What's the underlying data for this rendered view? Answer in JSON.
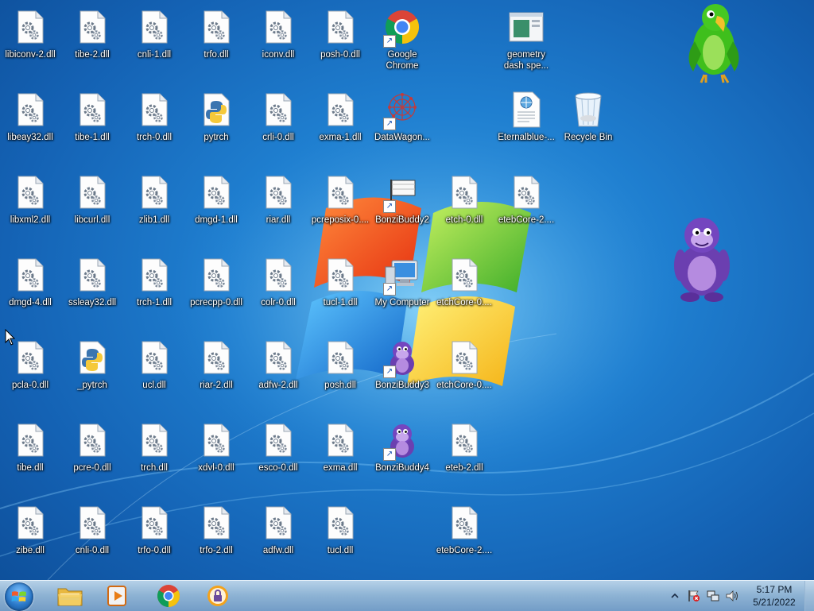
{
  "desktop": {
    "icons": [
      {
        "label": "libiconv-2.dll",
        "type": "dll"
      },
      {
        "label": "tibe-2.dll",
        "type": "dll"
      },
      {
        "label": "cnli-1.dll",
        "type": "dll"
      },
      {
        "label": "trfo.dll",
        "type": "dll"
      },
      {
        "label": "iconv.dll",
        "type": "dll"
      },
      {
        "label": "posh-0.dll",
        "type": "dll"
      },
      {
        "label": "Google Chrome",
        "type": "chrome-shortcut"
      },
      {
        "label": "geometry dash spe...",
        "type": "window-thumb"
      },
      {
        "label": "libeay32.dll",
        "type": "dll"
      },
      {
        "label": "tibe-1.dll",
        "type": "dll"
      },
      {
        "label": "trch-0.dll",
        "type": "dll"
      },
      {
        "label": "pytrch",
        "type": "python"
      },
      {
        "label": "crli-0.dll",
        "type": "dll"
      },
      {
        "label": "exma-1.dll",
        "type": "dll"
      },
      {
        "label": "DataWagon...",
        "type": "datawagon-shortcut"
      },
      {
        "label": "Eternalblue-...",
        "type": "html-doc"
      },
      {
        "label": "Recycle Bin",
        "type": "recycle-bin"
      },
      {
        "label": "libxml2.dll",
        "type": "dll"
      },
      {
        "label": "libcurl.dll",
        "type": "dll"
      },
      {
        "label": "zlib1.dll",
        "type": "dll"
      },
      {
        "label": "dmgd-1.dll",
        "type": "dll"
      },
      {
        "label": "riar.dll",
        "type": "dll"
      },
      {
        "label": "pcreposix-0....",
        "type": "dll"
      },
      {
        "label": "BonziBuddy2",
        "type": "flag-shortcut"
      },
      {
        "label": "etch-0.dll",
        "type": "dll"
      },
      {
        "label": "etebCore-2....",
        "type": "dll"
      },
      {
        "label": "dmgd-4.dll",
        "type": "dll"
      },
      {
        "label": "ssleay32.dll",
        "type": "dll"
      },
      {
        "label": "trch-1.dll",
        "type": "dll"
      },
      {
        "label": "pcrecpp-0.dll",
        "type": "dll"
      },
      {
        "label": "colr-0.dll",
        "type": "dll"
      },
      {
        "label": "tucl-1.dll",
        "type": "dll"
      },
      {
        "label": "My Computer",
        "type": "computer-shortcut"
      },
      {
        "label": "etchCore-0....",
        "type": "dll"
      },
      {
        "label": "pcla-0.dll",
        "type": "dll"
      },
      {
        "label": "_pytrch",
        "type": "python"
      },
      {
        "label": "ucl.dll",
        "type": "dll"
      },
      {
        "label": "riar-2.dll",
        "type": "dll"
      },
      {
        "label": "adfw-2.dll",
        "type": "dll"
      },
      {
        "label": "posh.dll",
        "type": "dll"
      },
      {
        "label": "BonziBuddy3",
        "type": "bonzi-shortcut"
      },
      {
        "label": "etchCore-0....",
        "type": "dll"
      },
      {
        "label": "tibe.dll",
        "type": "dll"
      },
      {
        "label": "pcre-0.dll",
        "type": "dll"
      },
      {
        "label": "trch.dll",
        "type": "dll"
      },
      {
        "label": "xdvl-0.dll",
        "type": "dll"
      },
      {
        "label": "esco-0.dll",
        "type": "dll"
      },
      {
        "label": "exma.dll",
        "type": "dll"
      },
      {
        "label": "BonziBuddy4",
        "type": "bonzi-shortcut"
      },
      {
        "label": "eteb-2.dll",
        "type": "dll"
      },
      {
        "label": "zibe.dll",
        "type": "dll"
      },
      {
        "label": "cnli-0.dll",
        "type": "dll"
      },
      {
        "label": "trfo-0.dll",
        "type": "dll"
      },
      {
        "label": "trfo-2.dll",
        "type": "dll"
      },
      {
        "label": "adfw.dll",
        "type": "dll"
      },
      {
        "label": "tucl.dll",
        "type": "dll"
      },
      {
        "label": "etebCore-2....",
        "type": "dll"
      }
    ]
  },
  "taskbar": {
    "start_icon": "windows-orb-icon",
    "pinned": [
      {
        "name": "file-explorer",
        "icon": "folder-icon"
      },
      {
        "name": "media-player",
        "icon": "media-player-icon"
      },
      {
        "name": "google-chrome",
        "icon": "chrome-icon"
      },
      {
        "name": "security-app",
        "icon": "lock-shield-icon"
      }
    ],
    "tray_icons": [
      "show-hidden-icons-icon",
      "action-center-flag-icon",
      "network-icon",
      "volume-icon"
    ],
    "clock": {
      "time": "5:17 PM",
      "date": "5/21/2022"
    }
  },
  "colors": {
    "desktop_blue": "#1f7fd0",
    "taskbar": "#a8c8e4",
    "label_text": "#ffffff"
  }
}
